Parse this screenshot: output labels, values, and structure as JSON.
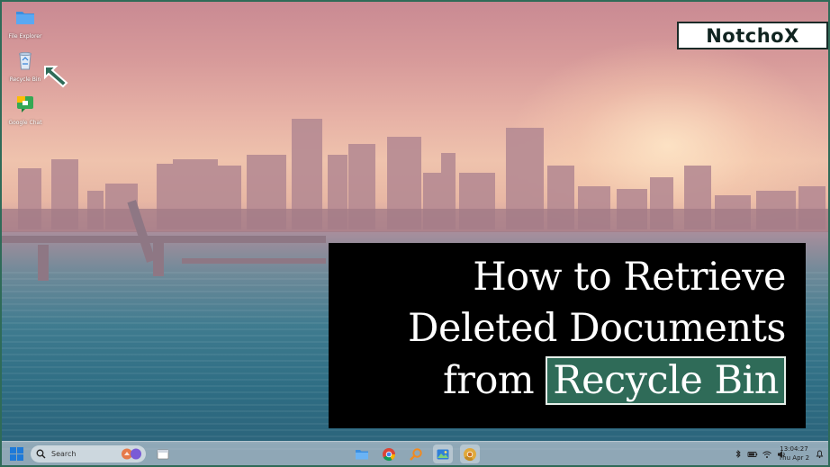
{
  "desktop": {
    "icons": [
      {
        "label": "File Explorer",
        "icon": "folder-icon"
      },
      {
        "label": "Recycle Bin",
        "icon": "recycle-bin-icon"
      },
      {
        "label": "Google Chat",
        "icon": "google-chat-icon"
      }
    ]
  },
  "logo": {
    "text": "NotchoX"
  },
  "headline": {
    "line1": "How to Retrieve",
    "line2": "Deleted Documents",
    "line3_prefix": "from",
    "line3_highlight": "Recycle Bin"
  },
  "taskbar": {
    "search_label": "Search",
    "pinned": [
      "file-explorer-icon",
      "chrome-icon",
      "search-app-icon",
      "photos-icon",
      "chrome-canary-icon"
    ],
    "clock_time": "13:04:27",
    "clock_date": "Thu Apr 2"
  },
  "colors": {
    "accent": "#2f6b58",
    "headline_bg": "#000000",
    "headline_text": "#ffffff"
  }
}
